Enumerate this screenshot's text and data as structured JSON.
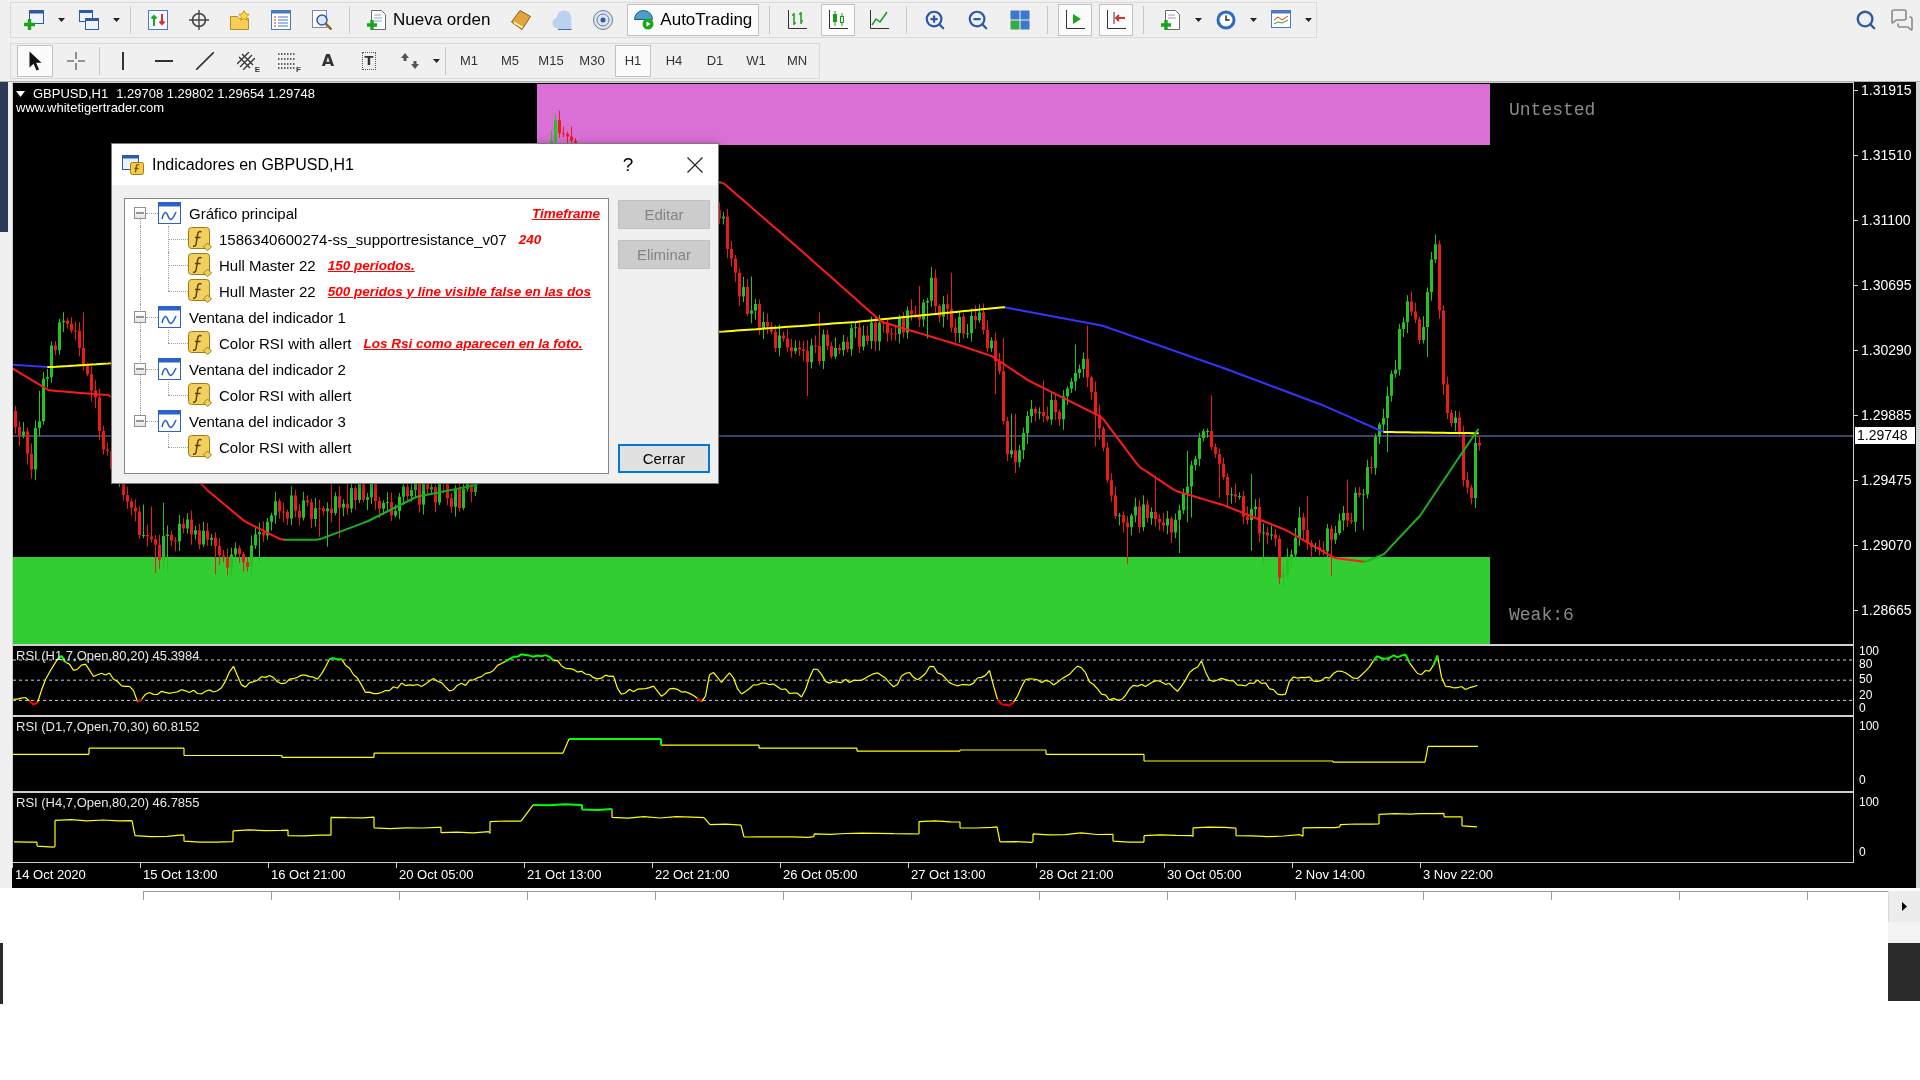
{
  "toolbar": {
    "new_order": {
      "label": "Nueva orden"
    },
    "autotrading": {
      "label": "AutoTrading",
      "on": true
    },
    "chart_types": [
      {
        "kind": "bars",
        "selected": false
      },
      {
        "kind": "candles",
        "selected": true
      },
      {
        "kind": "line",
        "selected": false
      }
    ],
    "auto_scroll": {
      "on": true
    },
    "chart_shift": {
      "on": true
    }
  },
  "drawing_toolbar": {
    "tools": [
      {
        "kind": "cursor",
        "selected": true
      },
      {
        "kind": "crosshair",
        "selected": false
      },
      {
        "kind": "vertical_line",
        "selected": false
      },
      {
        "kind": "horizontal_line",
        "selected": false
      },
      {
        "kind": "trendline",
        "selected": false
      },
      {
        "kind": "channel",
        "selected": false,
        "subscript": "E"
      },
      {
        "kind": "fibonacci",
        "selected": false,
        "subscript": "F"
      },
      {
        "kind": "text",
        "selected": false,
        "glyph": "A"
      },
      {
        "kind": "label",
        "selected": false,
        "glyph": "T"
      },
      {
        "kind": "arrows",
        "selected": false
      }
    ],
    "timeframes": [
      {
        "label": "M1",
        "selected": false
      },
      {
        "label": "M5",
        "selected": false
      },
      {
        "label": "M15",
        "selected": false
      },
      {
        "label": "M30",
        "selected": false
      },
      {
        "label": "H1",
        "selected": true
      },
      {
        "label": "H4",
        "selected": false
      },
      {
        "label": "D1",
        "selected": false
      },
      {
        "label": "W1",
        "selected": false
      },
      {
        "label": "MN",
        "selected": false
      }
    ]
  },
  "chart": {
    "symbol": "GBPUSD,H1",
    "ohlc": "1.29708 1.29802 1.29654 1.29748",
    "website": "www.whitetigertrader.com",
    "zones": [
      {
        "kind": "supply",
        "label": "Untested",
        "color": "#da70d6"
      },
      {
        "kind": "demand",
        "label": "Weak:6",
        "color": "#32cd32"
      }
    ],
    "price_axis": [
      "1.31915",
      "1.31510",
      "1.31100",
      "1.30695",
      "1.30290",
      "1.29885",
      "1.29475",
      "1.29070",
      "1.28665"
    ],
    "current_price": "1.29748"
  },
  "indicator_windows": [
    {
      "label": "RSI (H1,7,Open,80,20) 45.3984",
      "axis": [
        "100",
        "80",
        "50",
        "20",
        "0"
      ]
    },
    {
      "label": "RSI (D1,7,Open,70,30) 60.8152",
      "axis": [
        "100",
        "0"
      ]
    },
    {
      "label": "RSI (H4,7,Open,80,20) 46.7855",
      "axis": [
        "100",
        "0"
      ]
    }
  ],
  "time_axis": [
    "14 Oct 2020",
    "15 Oct 13:00",
    "16 Oct 21:00",
    "20 Oct 05:00",
    "21 Oct 13:00",
    "22 Oct 21:00",
    "26 Oct 05:00",
    "27 Oct 13:00",
    "28 Oct 21:00",
    "30 Oct 05:00",
    "2 Nov 14:00",
    "3 Nov 22:00"
  ],
  "dialog": {
    "title": "Indicadores en GBPUSD,H1",
    "help": "?",
    "tree": [
      {
        "label": "Gráfico principal",
        "expanded": true,
        "note": {
          "text": "Timeframe",
          "underlined": true
        },
        "children": [
          {
            "label": "1586340600274-ss_supportresistance_v07",
            "note": {
              "text": "240",
              "underlined": false
            }
          },
          {
            "label": "Hull Master 22",
            "note": {
              "text": "150 periodos.",
              "underlined": true
            }
          },
          {
            "label": "Hull Master 22",
            "note": {
              "text": "500 peridos y line visible false en las dos",
              "underlined": true
            }
          }
        ]
      },
      {
        "label": "Ventana del indicador 1",
        "expanded": true,
        "children": [
          {
            "label": "Color RSI with allert",
            "note": {
              "text": "Los Rsi como aparecen en la foto.",
              "underlined": true
            }
          }
        ]
      },
      {
        "label": "Ventana del indicador 2",
        "expanded": true,
        "children": [
          {
            "label": "Color RSI with allert"
          }
        ]
      },
      {
        "label": "Ventana del indicador 3",
        "expanded": true,
        "children": [
          {
            "label": "Color RSI with allert"
          }
        ]
      }
    ],
    "buttons": [
      {
        "label": "Editar",
        "disabled": true,
        "focused": false
      },
      {
        "label": "Eliminar",
        "disabled": true,
        "focused": false
      },
      {
        "label": "Cerrar",
        "disabled": false,
        "focused": true
      }
    ]
  }
}
